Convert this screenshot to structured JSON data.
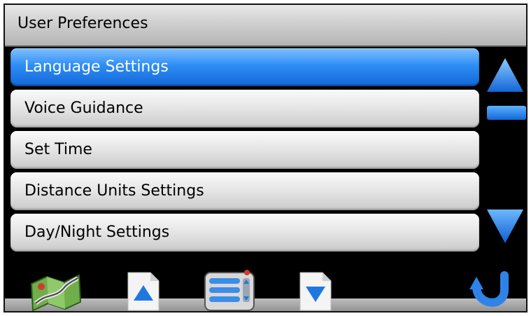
{
  "header": {
    "title": "User Preferences"
  },
  "menu": {
    "items": [
      {
        "label": "Language Settings",
        "selected": true
      },
      {
        "label": "Voice Guidance",
        "selected": false
      },
      {
        "label": "Set Time",
        "selected": false
      },
      {
        "label": "Distance Units Settings",
        "selected": false
      },
      {
        "label": "Day/Night Settings",
        "selected": false
      }
    ]
  },
  "scrollbar": {
    "up_icon": "triangle-up-icon",
    "down_icon": "triangle-down-icon",
    "thumb": "scroll-thumb"
  },
  "toolbar": {
    "icons": [
      "map-icon",
      "page-up-icon",
      "menu-list-icon",
      "page-down-icon",
      "back-arrow-icon"
    ]
  },
  "colors": {
    "accent": "#1a73e8",
    "selected_text": "#ffffff",
    "item_bg": "#dedede",
    "background": "#000000"
  }
}
